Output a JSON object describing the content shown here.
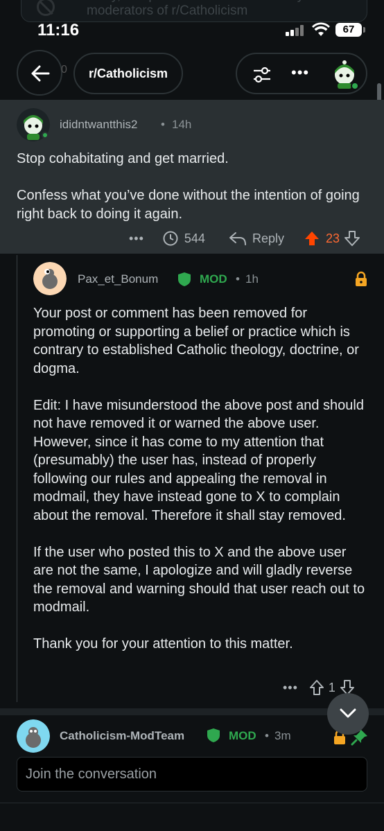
{
  "banner": {
    "text": "Sorry, this post has been removed by the moderators of r/Catholicism"
  },
  "status_bar": {
    "time": "11:16",
    "battery": "67"
  },
  "header": {
    "subreddit": "r/Catholicism",
    "peek_count": "0"
  },
  "comment": {
    "username": "ididntwantthis2",
    "age": "14h",
    "body": "Stop cohabitating and get married.\n\nConfess what you’ve done without the intention of going right back to doing it again.",
    "award_count": "544",
    "reply_label": "Reply",
    "score": "23"
  },
  "mod_reply": {
    "username": "Pax_et_Bonum",
    "badge": "MOD",
    "age": "1h",
    "body": "Your post or comment has been removed for promoting or supporting a belief or practice which is contrary to established Catholic theology, doctrine, or dogma.\n\nEdit: I have misunderstood the above post and should not have removed it or warned the above user. However, since it has come to my attention that (presumably) the user has, instead of properly following our rules and appealing the removal in modmail, they have instead gone to X to complain about the removal. Therefore it shall stay removed.\n\nIf the user who posted this to X and the above user are not the same, I apologize and will gladly reverse the removal and warning should that user reach out to modmail.\n\nThank you for your attention to this matter.",
    "score": "1"
  },
  "modteam": {
    "username": "Catholicism-ModTeam",
    "badge": "MOD",
    "age": "3m"
  },
  "composer": {
    "placeholder": "Join the conversation"
  },
  "colors": {
    "upvote_active": "#ff4500",
    "mod_green": "#2fa84f",
    "lock_orange": "#f5a623"
  }
}
